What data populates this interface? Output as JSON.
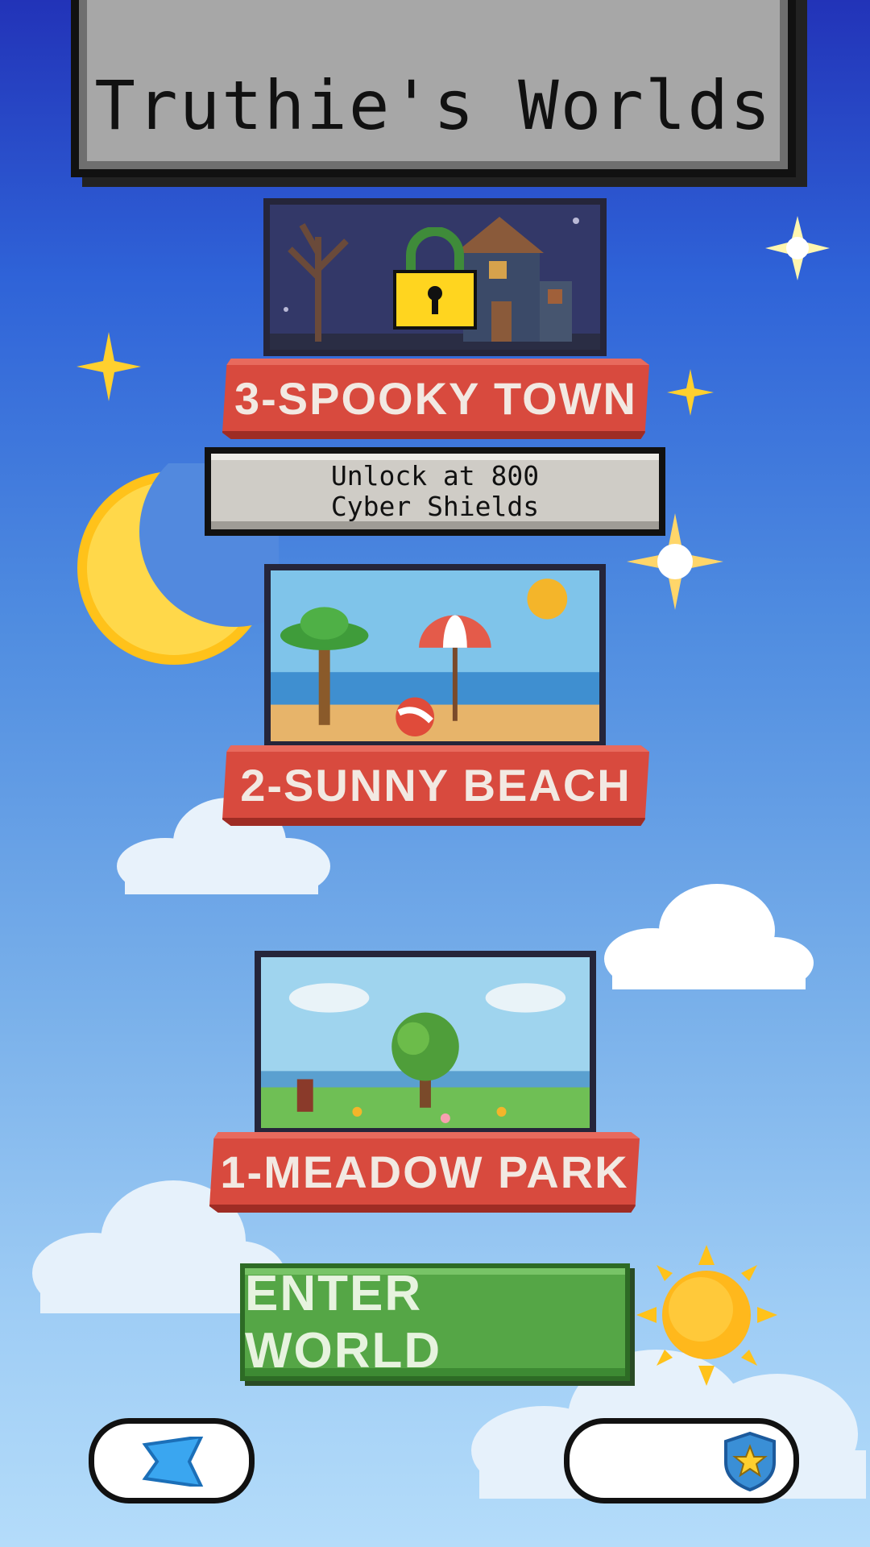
{
  "title": "Truthie's Worlds",
  "worlds": [
    {
      "label": "3-SPOOKY TOWN",
      "locked": true,
      "unlock_line1": "Unlock at 800",
      "unlock_line2": "Cyber Shields"
    },
    {
      "label": "2-SUNNY BEACH",
      "locked": false
    },
    {
      "label": "1-MEADOW PARK",
      "locked": false
    }
  ],
  "enter_button": "ENTER WORLD",
  "colors": {
    "ribbon": "#d84a3e",
    "enter_button": "#55a646",
    "title_board": "#a7a7a7"
  },
  "icons": {
    "back": "blue-gem-icon",
    "shield": "shield-star-icon",
    "lock": "padlock-icon"
  }
}
